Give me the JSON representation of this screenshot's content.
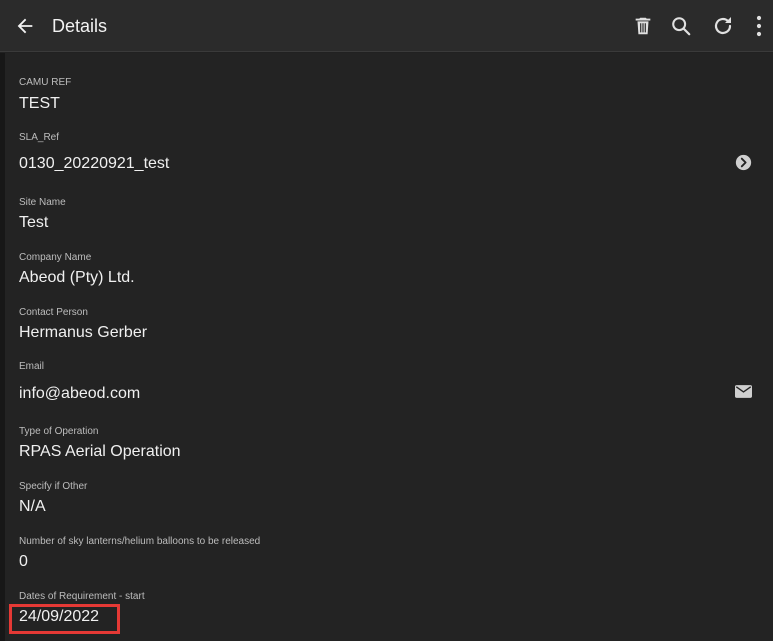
{
  "toolbar": {
    "title": "Details",
    "icons": {
      "back": "arrow-left-icon",
      "delete": "trash-icon",
      "search": "search-icon",
      "refresh": "refresh-icon",
      "more": "more-vertical-icon"
    }
  },
  "fields": {
    "camu_ref": {
      "label": "CAMU REF",
      "value": "TEST"
    },
    "sla_ref": {
      "label": "SLA_Ref",
      "value": "0130_20220921_test",
      "icon": "chevron-right-circle-icon"
    },
    "site_name": {
      "label": "Site Name",
      "value": "Test"
    },
    "company_name": {
      "label": "Company Name",
      "value": "Abeod (Pty) Ltd."
    },
    "contact_person": {
      "label": "Contact Person",
      "value": "Hermanus Gerber"
    },
    "email": {
      "label": "Email",
      "value": "info@abeod.com",
      "icon": "mail-icon"
    },
    "type_of_operation": {
      "label": "Type of Operation",
      "value": "RPAS Aerial Operation"
    },
    "specify_if_other": {
      "label": "Specify if Other",
      "value": "N/A"
    },
    "sky_lanterns": {
      "label": "Number of sky lanterns/helium balloons to be released",
      "value": "0"
    },
    "dates_start": {
      "label": "Dates of Requirement - start",
      "value": "24/09/2022"
    }
  },
  "colors": {
    "background": "#232323",
    "toolbar": "#2b2b2b",
    "text": "#f0f0f0",
    "label": "#bdbdbd",
    "icon": "#cfcfcf",
    "highlight": "#e53935"
  }
}
